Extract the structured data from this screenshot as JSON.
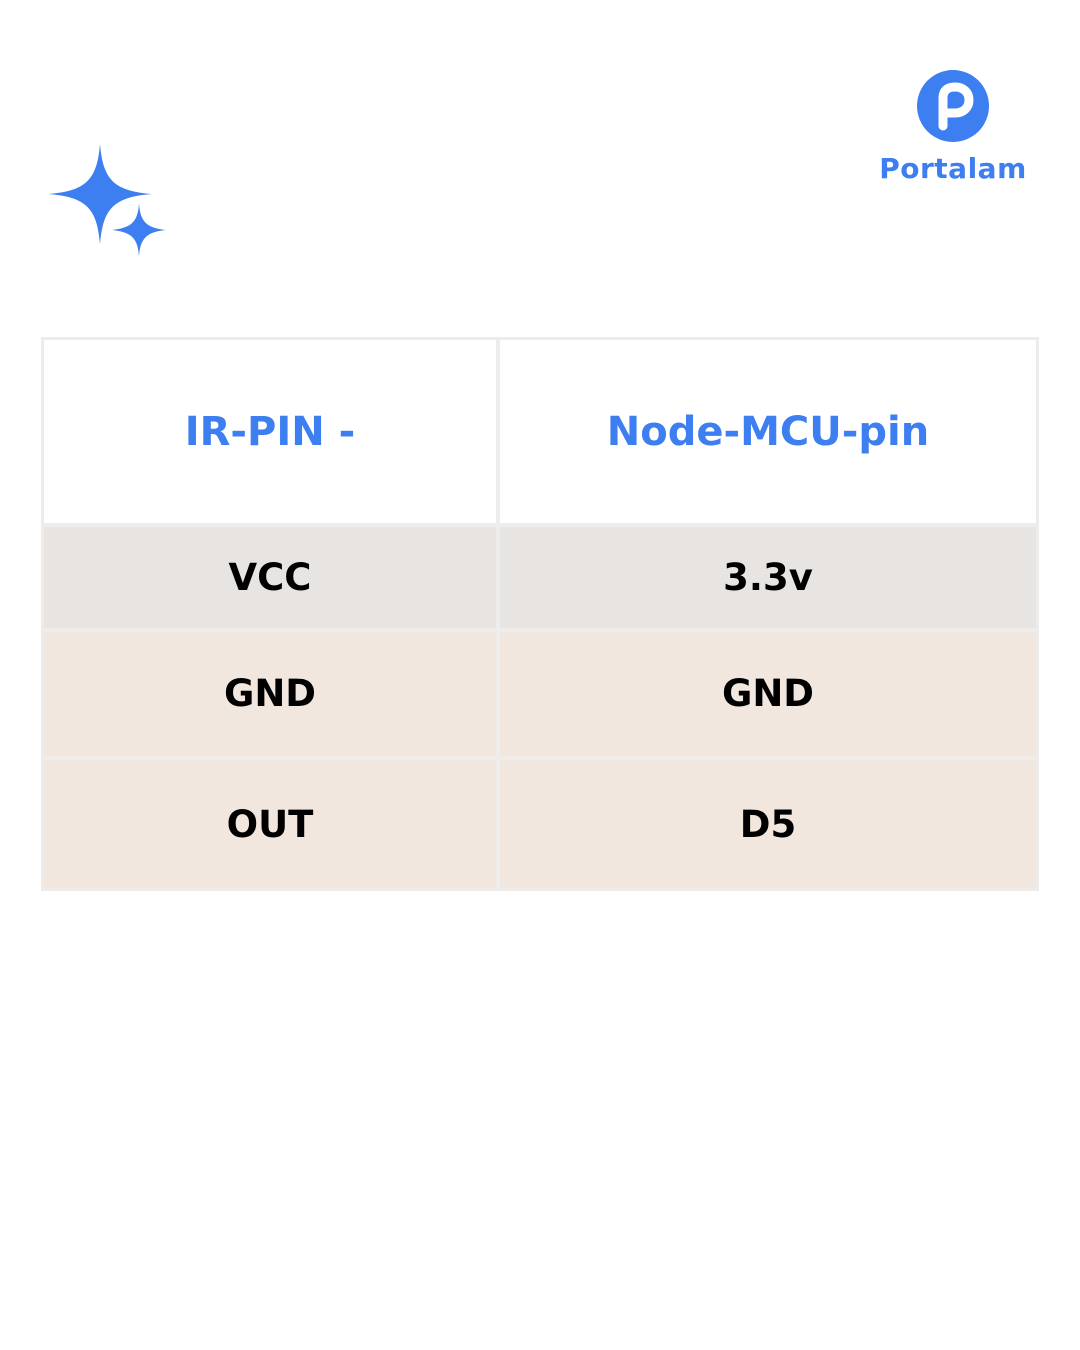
{
  "brand": {
    "name": "Portalam",
    "logo_icon": "portalam-p-logo-icon",
    "color": "#3d7ef0"
  },
  "decoration": {
    "icon": "sparkle-icon",
    "color": "#3d7ef0"
  },
  "table": {
    "headers": [
      "IR-PIN -",
      "Node-MCU-pin"
    ],
    "header_color": "#3d7ef0",
    "rows": [
      [
        "VCC",
        "3.3v"
      ],
      [
        "GND",
        "GND"
      ],
      [
        "OUT",
        "D5"
      ]
    ],
    "row_colors": [
      "#e7e4e1",
      "#f1e7de",
      "#f1e7de"
    ]
  }
}
